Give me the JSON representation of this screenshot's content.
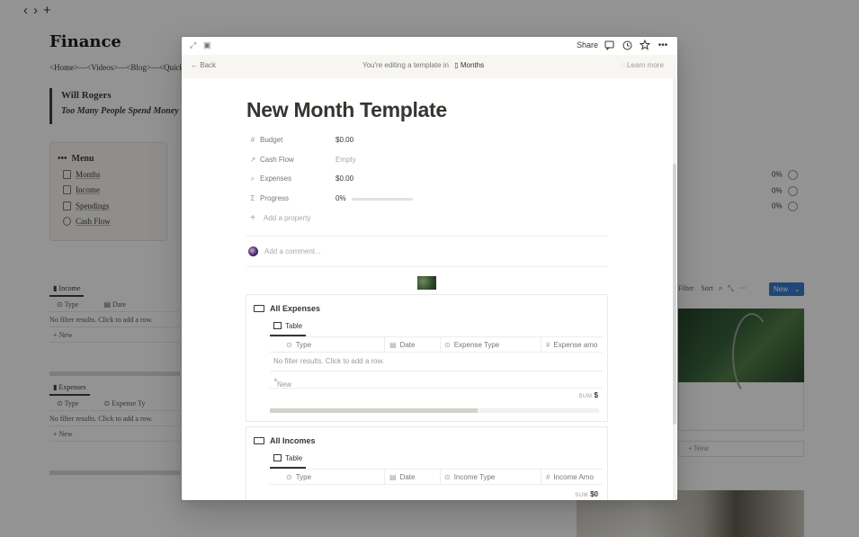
{
  "background": {
    "nav": {
      "back": "‹",
      "forward": "›",
      "add": "+"
    },
    "title": "Finance",
    "links": "<Home>—<Videos>—<Blog>—<Quick",
    "quote": {
      "author": "Will Rogers",
      "text": "Too Many People Spend Money"
    },
    "menu": {
      "heading": "Menu",
      "items": [
        {
          "label": "Months"
        },
        {
          "label": "Income"
        },
        {
          "label": "Spendings"
        },
        {
          "label": "Cash Flow"
        }
      ]
    },
    "income": {
      "tab": "Income",
      "col1": "Type",
      "col2": "Date",
      "empty": "No filter results. Click to add a row.",
      "new": "New"
    },
    "expenses": {
      "tab": "Expenses",
      "col1": "Type",
      "col2": "Expense Ty",
      "empty": "No filter results. Click to add a row.",
      "new": "New"
    },
    "percents": [
      "0%",
      "0%",
      "0%"
    ],
    "tools": {
      "filter": "Filter",
      "sort": "Sort",
      "more": "···",
      "new": "New"
    },
    "gallery_new": "New"
  },
  "modal": {
    "topbar": {
      "share": "Share"
    },
    "banner": {
      "back": "Back",
      "editing": "You're editing a template in",
      "page": "Months",
      "learn": "Learn more"
    },
    "title": "New Month Template",
    "properties": [
      {
        "icon": "#",
        "name": "Budget",
        "value": "$0.00"
      },
      {
        "icon": "↗",
        "name": "Cash Flow",
        "value": "Empty"
      },
      {
        "icon": "⌕",
        "name": "Expenses",
        "value": "$0.00"
      },
      {
        "icon": "Σ",
        "name": "Progress",
        "value": "0%",
        "progress": 0
      }
    ],
    "add_property": "Add a property",
    "comment_placeholder": "Add a comment...",
    "databases": [
      {
        "title": "All Expenses",
        "view": "Table",
        "columns": [
          {
            "icon": "⊙",
            "label": "Type"
          },
          {
            "icon": "▤",
            "label": "Date"
          },
          {
            "icon": "⊙",
            "label": "Expense Type"
          },
          {
            "icon": "#",
            "label": "Expense amo"
          }
        ],
        "empty": "No filter results. Click to add a row.",
        "new": "New",
        "sum_label": "SUM",
        "sum_value": "$"
      },
      {
        "title": "All Incomes",
        "view": "Table",
        "columns": [
          {
            "icon": "⊙",
            "label": "Type"
          },
          {
            "icon": "▤",
            "label": "Date"
          },
          {
            "icon": "⊙",
            "label": "Income Type"
          },
          {
            "icon": "#",
            "label": "Income Amo"
          }
        ],
        "sum_label": "SUM",
        "sum_value": "$0"
      }
    ]
  }
}
